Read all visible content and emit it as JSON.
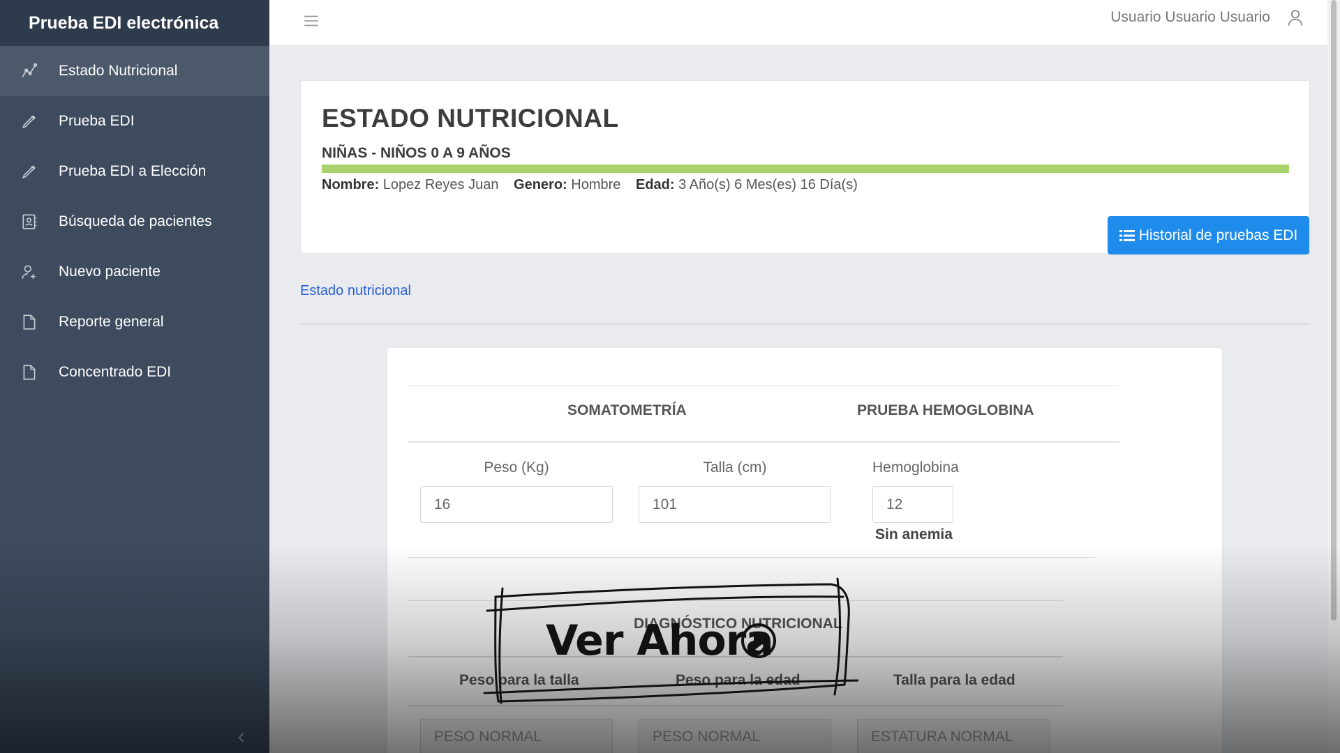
{
  "brand": "Prueba EDI electrónica",
  "sidebar": {
    "items": [
      {
        "label": "Estado Nutricional",
        "icon": "chart-line-icon",
        "active": true
      },
      {
        "label": "Prueba EDI",
        "icon": "pencil-icon"
      },
      {
        "label": "Prueba EDI a Elección",
        "icon": "pencil-icon"
      },
      {
        "label": "Búsqueda de pacientes",
        "icon": "address-book-icon"
      },
      {
        "label": "Nuevo paciente",
        "icon": "add-user-icon"
      },
      {
        "label": "Reporte general",
        "icon": "file-icon"
      },
      {
        "label": "Concentrado EDI",
        "icon": "file-icon"
      }
    ]
  },
  "topbar": {
    "user_name": "Usuario Usuario Usuario"
  },
  "header": {
    "title": "ESTADO NUTRICIONAL",
    "subtitle": "NIÑAS - NIÑOS 0 A 9 AÑOS",
    "patient": {
      "name_label": "Nombre:",
      "name": "Lopez Reyes Juan",
      "gender_label": "Genero:",
      "gender": "Hombre",
      "age_label": "Edad:",
      "age": "3 Año(s) 6 Mes(es) 16 Día(s)"
    },
    "history_button": "Historial de pruebas EDI"
  },
  "breadcrumb": "Estado nutricional",
  "tabs": [
    "SOMATOMETRÍA",
    "PRUEBA HEMOGLOBINA"
  ],
  "fields": {
    "peso": {
      "label": "Peso (Kg)",
      "value": "16"
    },
    "talla": {
      "label": "Talla (cm)",
      "value": "101"
    },
    "hemoglobina": {
      "label": "Hemoglobina",
      "value": "12",
      "status": "Sin anemia"
    }
  },
  "diagnostico": {
    "title": "DIAGNÓSTICO NUTRICIONAL",
    "columns": [
      {
        "label": "Peso para la talla",
        "value": "PESO NORMAL"
      },
      {
        "label": "Peso para la edad",
        "value": "PESO NORMAL"
      },
      {
        "label": "Talla para la edad",
        "value": "ESTATURA NORMAL"
      }
    ]
  },
  "cta": {
    "label": "Ver Ahora"
  }
}
